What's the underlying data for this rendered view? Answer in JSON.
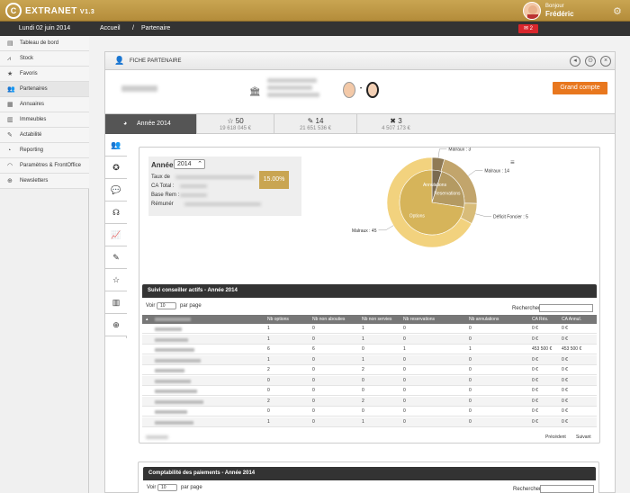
{
  "header": {
    "logo": "C",
    "brand": "EXTRANET",
    "version": "V1.3",
    "greeting": "Bonjour",
    "user_name": "Frédéric"
  },
  "datebar": {
    "date": "Lundi 02 juin 2014"
  },
  "breadcrumb": {
    "home": "Accueil",
    "sep": "/",
    "current": "Partenaire"
  },
  "mail_badge": {
    "count": "2"
  },
  "sidebar": {
    "items": [
      {
        "label": "Tableau de bord",
        "icon": "dashboard-icon"
      },
      {
        "label": "Stock",
        "icon": "chart-icon"
      },
      {
        "label": "Favoris",
        "icon": "star-icon"
      },
      {
        "label": "Partenaires",
        "icon": "users-icon"
      },
      {
        "label": "Annuaires",
        "icon": "book-icon"
      },
      {
        "label": "Immeubles",
        "icon": "building-icon"
      },
      {
        "label": "Actabilité",
        "icon": "pencil-icon"
      },
      {
        "label": "Reporting",
        "icon": "report-icon"
      },
      {
        "label": "Paramètres & FrontOffice",
        "icon": "wifi-icon"
      },
      {
        "label": "Newsletters",
        "icon": "globe-icon"
      }
    ]
  },
  "panel": {
    "title": "FICHE PARTENAIRE",
    "grand_compte": "Grand compte"
  },
  "year_tabs": {
    "active": "Année 2014",
    "stats": [
      {
        "value": "50",
        "sub": "19 618 045 €",
        "icon": "star-icon"
      },
      {
        "value": "14",
        "sub": "21 651 536 €",
        "icon": "pencil-icon"
      },
      {
        "value": "3",
        "sub": "4 507 173 €",
        "icon": "close-icon"
      }
    ]
  },
  "year_form": {
    "label": "Année",
    "selected": "2014",
    "lines": [
      "Taux de",
      "CA Total :",
      "Base Rem :",
      "Rémunér"
    ],
    "percent": "15.00%"
  },
  "chart_data": {
    "type": "pie",
    "inner": [
      {
        "name": "Annulations",
        "value": 3
      },
      {
        "name": "Reservations",
        "value": 14
      },
      {
        "name": "Options",
        "value": 45
      }
    ],
    "outer": [
      {
        "name": "Malraux : 3",
        "value": 3
      },
      {
        "name": "Malraux : 14",
        "value": 14
      },
      {
        "name": "Déficit Foncier : 5",
        "value": 5
      },
      {
        "name": "Malraux : 45",
        "value": 45
      }
    ],
    "colors": {
      "inner_annul": "#7a6a50",
      "inner_resa": "#b49a62",
      "inner_opt": "#d6b45a",
      "outer_a": "#8f7a55",
      "outer_b": "#c2a56c",
      "outer_c": "#d8bc79",
      "outer_d": "#f2d27e"
    }
  },
  "table1": {
    "title": "Suivi conseiller actifs - Année 2014",
    "show_prefix": "Voir",
    "show_value": "10",
    "show_suffix": "par page",
    "search_label": "Rechercher",
    "columns": [
      "Nb options",
      "Nb non abouties",
      "Nb non servies",
      "Nb reservations",
      "Nb annulations",
      "CA Rés.",
      "CA Annul."
    ],
    "rows": [
      [
        "1",
        "0",
        "1",
        "0",
        "0",
        "0 €",
        "0 €"
      ],
      [
        "1",
        "0",
        "1",
        "0",
        "0",
        "0 €",
        "0 €"
      ],
      [
        "6",
        "6",
        "0",
        "1",
        "1",
        "453 500 €",
        "453 500 €"
      ],
      [
        "1",
        "0",
        "1",
        "0",
        "0",
        "0 €",
        "0 €"
      ],
      [
        "2",
        "0",
        "2",
        "0",
        "0",
        "0 €",
        "0 €"
      ],
      [
        "0",
        "0",
        "0",
        "0",
        "0",
        "0 €",
        "0 €"
      ],
      [
        "0",
        "0",
        "0",
        "0",
        "0",
        "0 €",
        "0 €"
      ],
      [
        "2",
        "0",
        "2",
        "0",
        "0",
        "0 €",
        "0 €"
      ],
      [
        "0",
        "0",
        "0",
        "0",
        "0",
        "0 €",
        "0 €"
      ],
      [
        "1",
        "0",
        "1",
        "0",
        "0",
        "0 €",
        "0 €"
      ]
    ],
    "prev": "Précédent",
    "next": "Suivant"
  },
  "table2": {
    "title": "Comptabilité des paiements - Année 2014",
    "show_prefix": "Voir",
    "show_value": "10",
    "show_suffix": "par page",
    "search_label": "Rechercher"
  }
}
